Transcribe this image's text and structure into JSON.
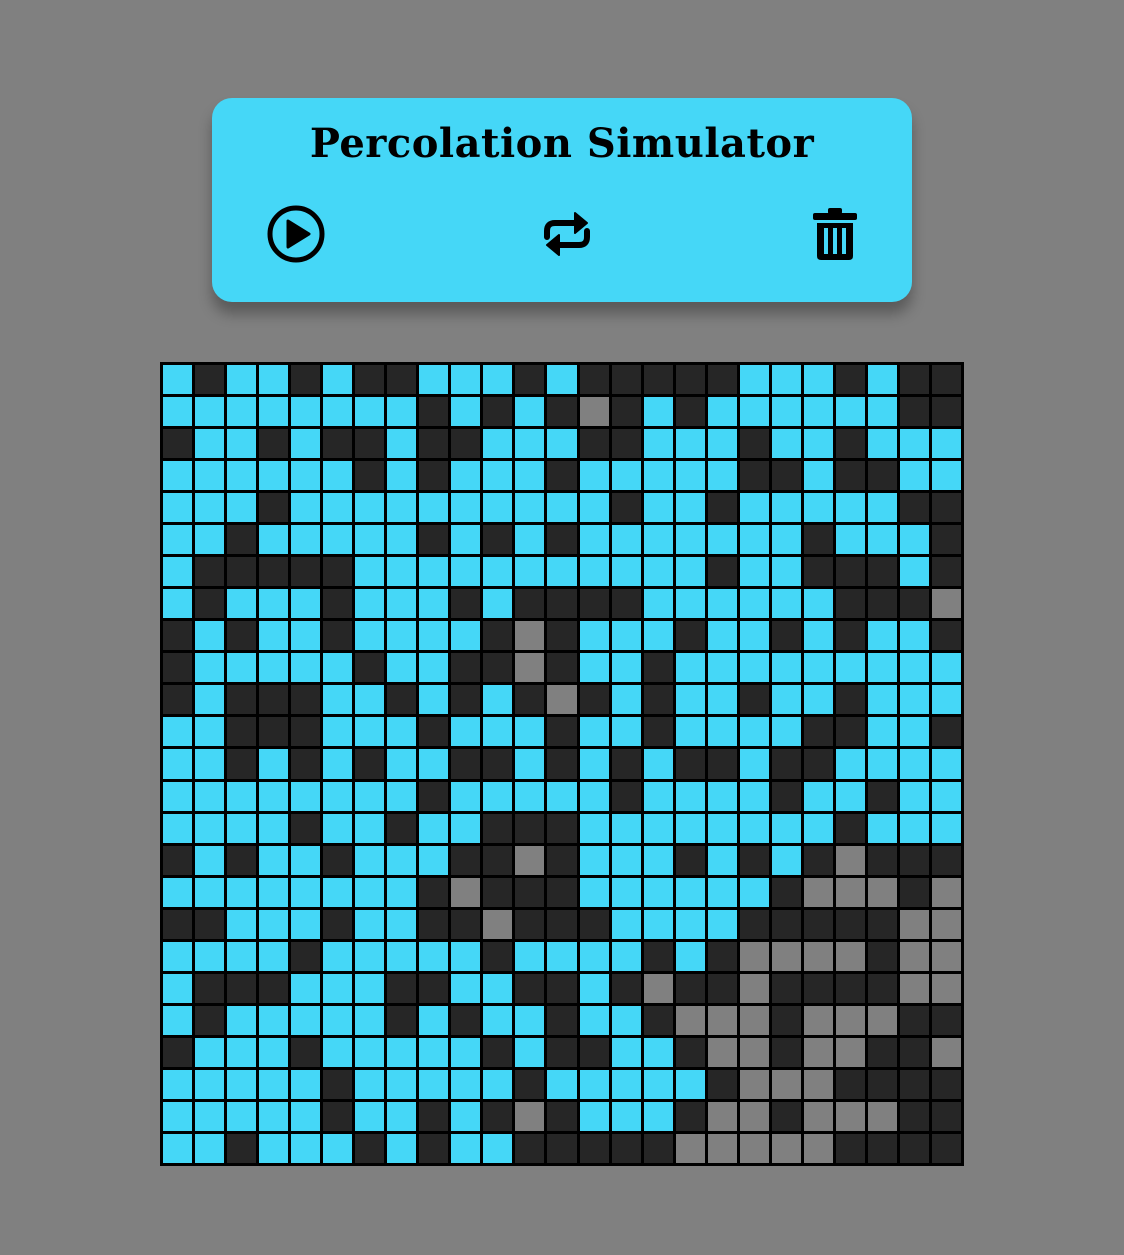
{
  "title": "Percolation Simulator",
  "colors": {
    "background": "#808080",
    "panel": "#45d7f7",
    "water": "#45d7f7",
    "blocked": "#262626",
    "open": "#808080",
    "grid_line": "#000000"
  },
  "toolbar": {
    "play_icon": "play-circle-icon",
    "reset_icon": "repeat-icon",
    "clear_icon": "trash-icon"
  },
  "grid": {
    "size": 25,
    "legend": {
      "W": "water-filled",
      "B": "blocked",
      "O": "open"
    },
    "rows": [
      "WBWWBWBBWWWBWBBBBBWWWBWBB",
      "WWWWWWWWBWBWBOBWBWWWWWWBB",
      "BWWBWBBWBBWWWBBWWWBWWBWWW",
      "WWWWWWBWBWWWBWWWWWBBWBBWW",
      "WWWBWWWWWWWWWWBWWBWWWWWBB",
      "WWBWWWWWBWBWBWWWWWWWBWWWB",
      "WBBBBBWWWWWWWWWWWBWWBBBWB",
      "WBWWWBWWWBWBBBBWWWWWWBBBO",
      "BWBWWBWWWWBOBWWWBWWBWBWWB",
      "BWWWWWBWWBBOBWWBWWWWWWWWW",
      "BWBBBWWBWBWBOBWBWWBWWBWWW",
      "WWBBBWWWBWWWBWWBWWWWBBWWB",
      "WWBWBWBWWBBWBWBWBBWBBWWWW",
      "WWWWWWWWBWWWWWBWWWWBWWBWW",
      "WWWWBWWBWWBBBWWWWWWWWBWWW",
      "BWBWWBWWWBBOBWWWBWBWBOBBB",
      "WWWWWWWWBOBBBWWWWWWBOOOBO",
      "BBWWWBWWBBOBBBWWWWBBBBBOO",
      "WWWWBWWWWWBWWWWBWBOOOOBOO",
      "WBBBWWWBBWWBBWBOBBOBBBBOO",
      "WBWWWWWBWBWWBWWBOOOBOOOBB",
      "BWWWBWWWWWBWBBWWBOOBOOBBO",
      "WWWWWBWWWWWBWWWWWBOOOBBBB",
      "WWWWWBWWBWBOBWWWBOOBOOOBB",
      "WWBWWWBWBWWBBBBBOOOOOBBBB"
    ]
  }
}
